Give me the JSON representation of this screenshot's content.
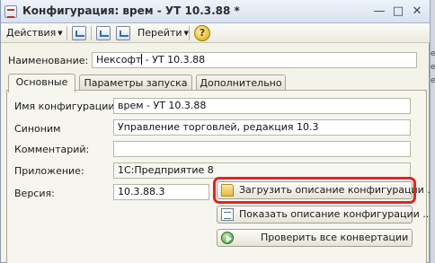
{
  "window": {
    "title": "Конфигурация: врем - УТ 10.3.88 *",
    "controls": {
      "close": "✕",
      "minimize": "—",
      "maximize": "□"
    }
  },
  "toolbar": {
    "actions_label": "Действия",
    "goto_label": "Перейти",
    "help_label": "?"
  },
  "name_field": {
    "label": "Наименование:",
    "value_before_caret": "Нексофт",
    "value_after_caret": " - УТ 10.3.88"
  },
  "tabs": [
    {
      "label": "Основные",
      "active": true
    },
    {
      "label": "Параметры запуска",
      "active": false
    },
    {
      "label": "Дополнительно",
      "active": false
    }
  ],
  "fields": {
    "config_name": {
      "label": "Имя конфигурации:",
      "value": "врем - УТ 10.3.88"
    },
    "synonym": {
      "label": "Синоним",
      "value": "Управление торговлей, редакция 10.3"
    },
    "comment": {
      "label": "Комментарий:",
      "value": ""
    },
    "application": {
      "label": "Приложение:",
      "value": "1С:Предприятие 8"
    },
    "version": {
      "label": "Версия:",
      "value": "10.3.88.3"
    }
  },
  "buttons": {
    "load_description": "Загрузить описание конфигурации ...",
    "show_description": "Показать описание конфигурации ...",
    "check_conversions": "Проверить все конвертации"
  },
  "right_strip": [
    "е 8",
    "е 8",
    "е 8"
  ],
  "colors": {
    "highlight": "#e02424",
    "window_bg": "#f4f3ea",
    "titlebar": "#d8e2ef"
  }
}
